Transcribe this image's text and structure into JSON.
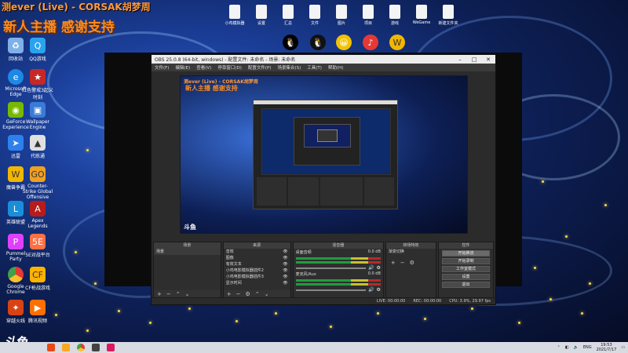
{
  "stream": {
    "title": "测ever (Live) - CORSAK胡梦周",
    "subtitle": "新人主播 感谢支持"
  },
  "desktop_left_icons": [
    {
      "label": "回收站",
      "icon": "recycle-bin-icon",
      "color": "#7fb0e8"
    },
    {
      "label": "QQ游戏",
      "icon": "qq-game-icon",
      "color": "#29a3ef"
    },
    {
      "label": "Microsoft Edge",
      "icon": "edge-icon",
      "color": "#1e88e5"
    },
    {
      "label": "红色警戒3起义时刻",
      "icon": "red-alert-icon",
      "color": "#c62828"
    },
    {
      "label": "GeForce Experience",
      "icon": "geforce-icon",
      "color": "#76b900"
    },
    {
      "label": "Wallpaper Engine",
      "icon": "wallpaper-engine-icon",
      "color": "#3a7bd5"
    },
    {
      "label": "迅雷",
      "icon": "xunlei-icon",
      "color": "#2f80ed"
    },
    {
      "label": "代练通",
      "icon": "dailiantong-icon",
      "color": "#e0e0e0"
    },
    {
      "label": "魔兽争霸",
      "icon": "warcraft-icon",
      "color": "#f2b600"
    },
    {
      "label": "Counter-Strike Global Offensive",
      "icon": "csgo-icon",
      "color": "#f0a020"
    },
    {
      "label": "英雄联盟",
      "icon": "lol-icon",
      "color": "#1a8fd8"
    },
    {
      "label": "Apex Legends",
      "icon": "apex-icon",
      "color": "#b71c1c"
    },
    {
      "label": "Pummel Party",
      "icon": "pummel-party-icon",
      "color": "#e040fb"
    },
    {
      "label": "5E对战平台",
      "icon": "5e-icon",
      "color": "#ff7043"
    },
    {
      "label": "Google Chrome",
      "icon": "chrome-icon",
      "color": "#e53935"
    },
    {
      "label": "CF枪战游戏",
      "icon": "cf-icon",
      "color": "#ffb300"
    },
    {
      "label": "穿越火线",
      "icon": "crossfire-icon",
      "color": "#d84315"
    },
    {
      "label": "腾讯视频",
      "icon": "tencent-video-icon",
      "color": "#ff6f00"
    }
  ],
  "desktop_top_icons": [
    {
      "label": "小鸡模拟器",
      "icon": "file-icon"
    },
    {
      "label": "设置",
      "icon": "file-icon"
    },
    {
      "label": "汇总",
      "icon": "file-icon"
    },
    {
      "label": "文件",
      "icon": "file-icon"
    },
    {
      "label": "图片",
      "icon": "file-icon"
    },
    {
      "label": "项目",
      "icon": "file-icon"
    },
    {
      "label": "游戏",
      "icon": "file-icon"
    },
    {
      "label": "WeGame",
      "icon": "file-icon"
    },
    {
      "label": "新建文件夹",
      "icon": "file-icon"
    },
    {
      "label": "新建文件夹",
      "icon": "file-icon"
    }
  ],
  "obs": {
    "window_title": "OBS 25.0.8 (64-bit, windows) - 配置文件: 未命名 - 场景: 未命名",
    "menu": [
      "文件(F)",
      "编辑(E)",
      "查看(V)",
      "停靠窗口(D)",
      "配置文件(P)",
      "场景集合(S)",
      "工具(T)",
      "帮助(H)"
    ],
    "docks": {
      "scenes": {
        "title": "场景",
        "items": [
          "场景"
        ]
      },
      "sources": {
        "title": "来源",
        "items": [
          "音效",
          "图像",
          "有效文本",
          "小鸡电影模拟器插件2",
          "小鸡电影模拟器插件3",
          "显示时间"
        ]
      },
      "mixer": {
        "title": "混音器",
        "channels": [
          {
            "name": "桌面音频",
            "db": "0.0 dB"
          },
          {
            "name": "麦克风/Aux",
            "db": "0.0 dB"
          }
        ]
      },
      "transitions": {
        "title": "转场特效",
        "item": "渐变切换"
      },
      "controls": {
        "title": "控件",
        "buttons": [
          "开始推流",
          "开始录制",
          "工作室模式",
          "设置",
          "退出"
        ]
      }
    },
    "status": {
      "live": "LIVE: 00:00:00",
      "rec": "REC: 00:00:00",
      "cpu": "CPU: 3.9%, 29.97 fps"
    }
  },
  "logo": "斗鱼",
  "taskbar": {
    "tray_lang": "ENG",
    "time": "19:53",
    "date": "2021/7/17"
  }
}
